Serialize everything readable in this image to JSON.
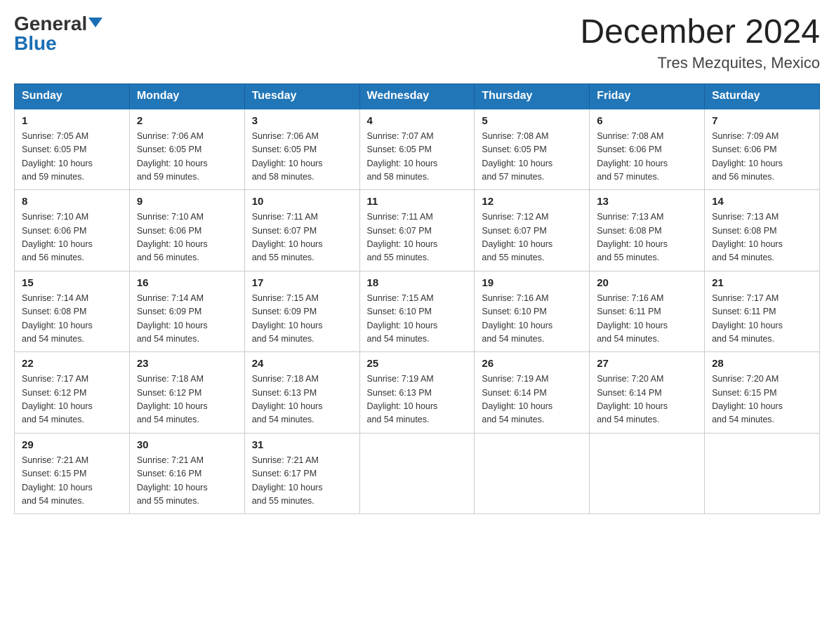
{
  "header": {
    "logo_general": "General",
    "logo_blue": "Blue",
    "month_title": "December 2024",
    "location": "Tres Mezquites, Mexico"
  },
  "days_of_week": [
    "Sunday",
    "Monday",
    "Tuesday",
    "Wednesday",
    "Thursday",
    "Friday",
    "Saturday"
  ],
  "weeks": [
    [
      {
        "day": "1",
        "sunrise": "7:05 AM",
        "sunset": "6:05 PM",
        "daylight": "10 hours and 59 minutes."
      },
      {
        "day": "2",
        "sunrise": "7:06 AM",
        "sunset": "6:05 PM",
        "daylight": "10 hours and 59 minutes."
      },
      {
        "day": "3",
        "sunrise": "7:06 AM",
        "sunset": "6:05 PM",
        "daylight": "10 hours and 58 minutes."
      },
      {
        "day": "4",
        "sunrise": "7:07 AM",
        "sunset": "6:05 PM",
        "daylight": "10 hours and 58 minutes."
      },
      {
        "day": "5",
        "sunrise": "7:08 AM",
        "sunset": "6:05 PM",
        "daylight": "10 hours and 57 minutes."
      },
      {
        "day": "6",
        "sunrise": "7:08 AM",
        "sunset": "6:06 PM",
        "daylight": "10 hours and 57 minutes."
      },
      {
        "day": "7",
        "sunrise": "7:09 AM",
        "sunset": "6:06 PM",
        "daylight": "10 hours and 56 minutes."
      }
    ],
    [
      {
        "day": "8",
        "sunrise": "7:10 AM",
        "sunset": "6:06 PM",
        "daylight": "10 hours and 56 minutes."
      },
      {
        "day": "9",
        "sunrise": "7:10 AM",
        "sunset": "6:06 PM",
        "daylight": "10 hours and 56 minutes."
      },
      {
        "day": "10",
        "sunrise": "7:11 AM",
        "sunset": "6:07 PM",
        "daylight": "10 hours and 55 minutes."
      },
      {
        "day": "11",
        "sunrise": "7:11 AM",
        "sunset": "6:07 PM",
        "daylight": "10 hours and 55 minutes."
      },
      {
        "day": "12",
        "sunrise": "7:12 AM",
        "sunset": "6:07 PM",
        "daylight": "10 hours and 55 minutes."
      },
      {
        "day": "13",
        "sunrise": "7:13 AM",
        "sunset": "6:08 PM",
        "daylight": "10 hours and 55 minutes."
      },
      {
        "day": "14",
        "sunrise": "7:13 AM",
        "sunset": "6:08 PM",
        "daylight": "10 hours and 54 minutes."
      }
    ],
    [
      {
        "day": "15",
        "sunrise": "7:14 AM",
        "sunset": "6:08 PM",
        "daylight": "10 hours and 54 minutes."
      },
      {
        "day": "16",
        "sunrise": "7:14 AM",
        "sunset": "6:09 PM",
        "daylight": "10 hours and 54 minutes."
      },
      {
        "day": "17",
        "sunrise": "7:15 AM",
        "sunset": "6:09 PM",
        "daylight": "10 hours and 54 minutes."
      },
      {
        "day": "18",
        "sunrise": "7:15 AM",
        "sunset": "6:10 PM",
        "daylight": "10 hours and 54 minutes."
      },
      {
        "day": "19",
        "sunrise": "7:16 AM",
        "sunset": "6:10 PM",
        "daylight": "10 hours and 54 minutes."
      },
      {
        "day": "20",
        "sunrise": "7:16 AM",
        "sunset": "6:11 PM",
        "daylight": "10 hours and 54 minutes."
      },
      {
        "day": "21",
        "sunrise": "7:17 AM",
        "sunset": "6:11 PM",
        "daylight": "10 hours and 54 minutes."
      }
    ],
    [
      {
        "day": "22",
        "sunrise": "7:17 AM",
        "sunset": "6:12 PM",
        "daylight": "10 hours and 54 minutes."
      },
      {
        "day": "23",
        "sunrise": "7:18 AM",
        "sunset": "6:12 PM",
        "daylight": "10 hours and 54 minutes."
      },
      {
        "day": "24",
        "sunrise": "7:18 AM",
        "sunset": "6:13 PM",
        "daylight": "10 hours and 54 minutes."
      },
      {
        "day": "25",
        "sunrise": "7:19 AM",
        "sunset": "6:13 PM",
        "daylight": "10 hours and 54 minutes."
      },
      {
        "day": "26",
        "sunrise": "7:19 AM",
        "sunset": "6:14 PM",
        "daylight": "10 hours and 54 minutes."
      },
      {
        "day": "27",
        "sunrise": "7:20 AM",
        "sunset": "6:14 PM",
        "daylight": "10 hours and 54 minutes."
      },
      {
        "day": "28",
        "sunrise": "7:20 AM",
        "sunset": "6:15 PM",
        "daylight": "10 hours and 54 minutes."
      }
    ],
    [
      {
        "day": "29",
        "sunrise": "7:21 AM",
        "sunset": "6:15 PM",
        "daylight": "10 hours and 54 minutes."
      },
      {
        "day": "30",
        "sunrise": "7:21 AM",
        "sunset": "6:16 PM",
        "daylight": "10 hours and 55 minutes."
      },
      {
        "day": "31",
        "sunrise": "7:21 AM",
        "sunset": "6:17 PM",
        "daylight": "10 hours and 55 minutes."
      },
      null,
      null,
      null,
      null
    ]
  ]
}
